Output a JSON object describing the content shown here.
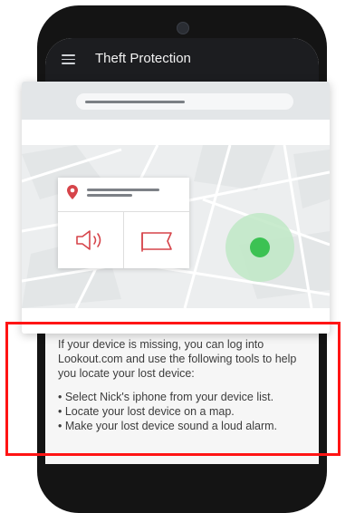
{
  "app_bar": {
    "title": "Theft Protection",
    "menu_icon": "hamburger-menu-icon"
  },
  "description": {
    "intro": "If your device is missing, you can log into Lookout.com and use the following tools to help you locate your lost device:",
    "bullets": [
      "• Select Nick's iphone from your device list.",
      "• Locate your lost device on a map.",
      "• Make your lost device sound a loud alarm."
    ]
  },
  "illustration": {
    "pin_icon": "map-pin-icon",
    "sound_icon": "speaker-sound-icon",
    "message_icon": "message-flag-icon",
    "device_location_color": "#3cc253"
  },
  "colors": {
    "accent_red": "#d6444a",
    "app_bar": "#1c1d20",
    "highlight_frame": "#ff1414"
  }
}
